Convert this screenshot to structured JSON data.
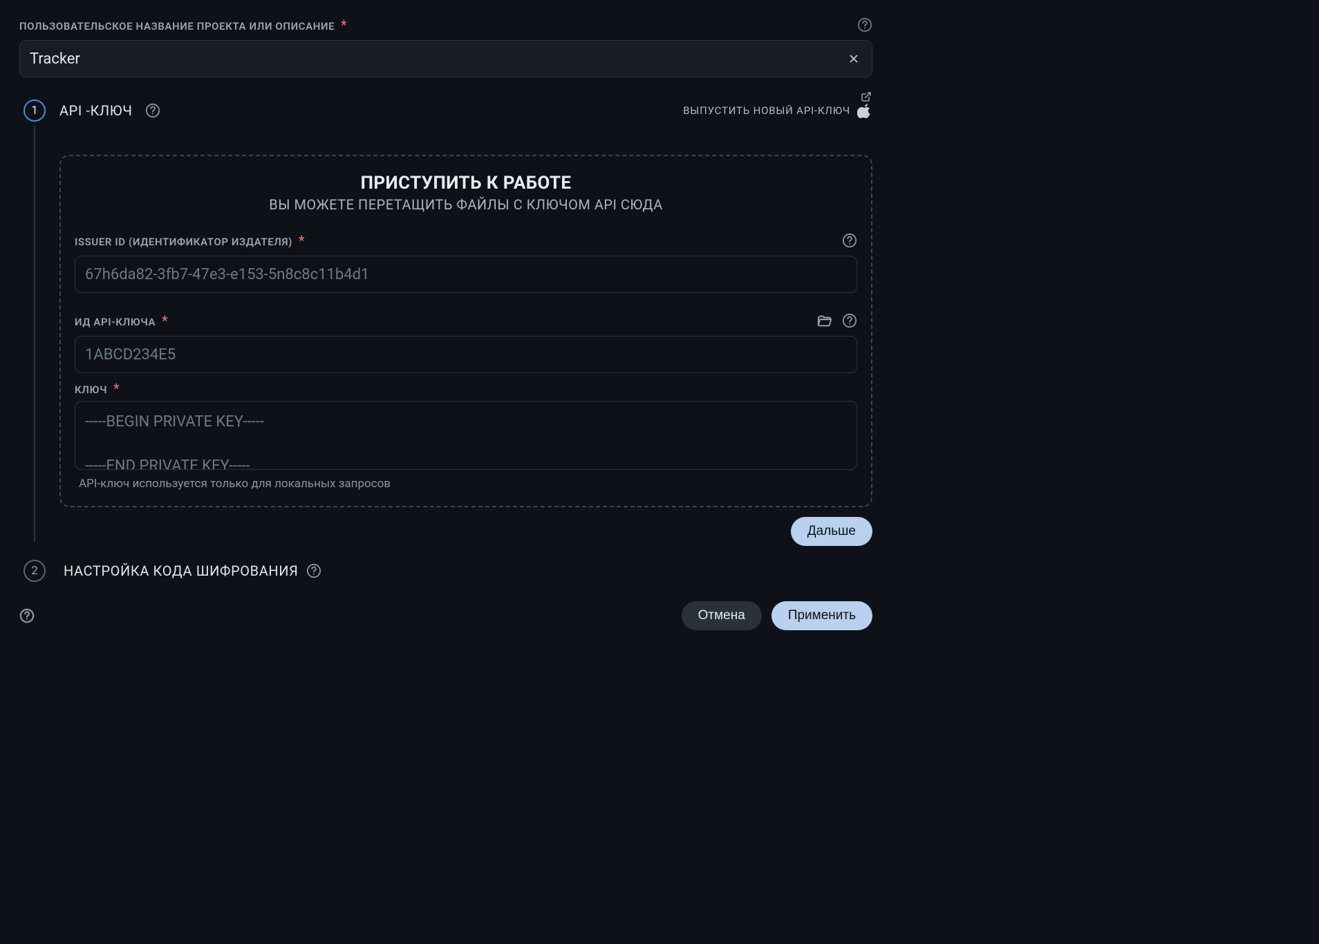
{
  "project": {
    "label": "ПОЛЬЗОВАТЕЛЬСКОЕ НАЗВАНИЕ ПРОЕКТА ИЛИ ОПИСАНИЕ",
    "value": "Tracker"
  },
  "step1": {
    "number": "1",
    "title": "API -КЛЮЧ",
    "issueLink": "ВЫПУСТИТЬ НОВЫЙ API-КЛЮЧ",
    "dashedTitle": "ПРИСТУПИТЬ К РАБОТЕ",
    "dashedSub": "ВЫ МОЖЕТЕ ПЕРЕТАЩИТЬ ФАЙЛЫ С КЛЮЧОМ API СЮДА",
    "issuerId": {
      "label": "ISSUER ID (ИДЕНТИФИКАТОР ИЗДАТЕЛЯ)",
      "placeholder": "67h6da82-3fb7-47e3-e153-5n8c8c11b4d1"
    },
    "apiKeyId": {
      "label": "ИД API-КЛЮЧА",
      "placeholder": "1ABCD234E5"
    },
    "key": {
      "label": "КЛЮЧ",
      "placeholder": "-----BEGIN PRIVATE KEY-----\n\n-----END PRIVATE KEY-----"
    },
    "hint": "API-ключ используется только для локальных запросов",
    "nextBtn": "Дальше"
  },
  "step2": {
    "number": "2",
    "title": "НАСТРОЙКА КОДА ШИФРОВАНИЯ"
  },
  "footer": {
    "cancel": "Отмена",
    "apply": "Применить"
  }
}
